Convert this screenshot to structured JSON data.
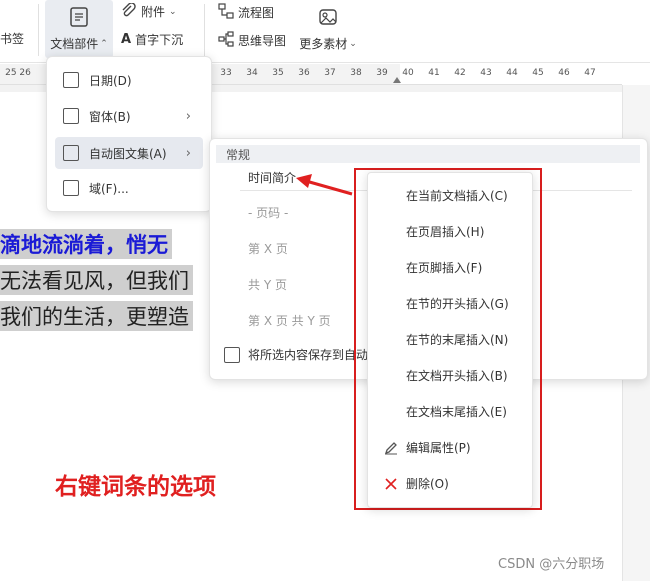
{
  "ribbon": {
    "bookmark_label": "书签",
    "doc_parts_label": "文档部件",
    "attachment_label": "附件",
    "drop_cap_label": "首字下沉",
    "flowchart_label": "流程图",
    "mindmap_label": "思维导图",
    "more_material_label": "更多素材"
  },
  "ruler": {
    "left_label": "25 26",
    "numbers": [
      "33",
      "34",
      "35",
      "36",
      "37",
      "38",
      "39",
      "40",
      "41",
      "42",
      "43",
      "44",
      "45",
      "46",
      "47"
    ]
  },
  "document": {
    "line1": "滴地流淌着，悄无",
    "line1_color": "#1a1ad6",
    "line2": "无法看见风，但我们",
    "line3": "我们的生活，更塑造"
  },
  "doc_parts_menu": {
    "items": [
      {
        "label": "日期(D)",
        "icon": "calendar-icon"
      },
      {
        "label": "窗体(B)",
        "icon": "form-icon"
      },
      {
        "label": "自动图文集(A)",
        "icon": "autotext-icon"
      },
      {
        "label": "域(F)...",
        "icon": "field-icon"
      }
    ]
  },
  "autotext_menu": {
    "header": "常规",
    "entries": [
      "时间简介",
      "- 页码 -",
      "第 X 页",
      "共 Y 页",
      "第 X 页 共 Y 页"
    ],
    "save_label": "将所选内容保存到自动"
  },
  "context_menu": {
    "items": [
      "在当前文档插入(C)",
      "在页眉插入(H)",
      "在页脚插入(F)",
      "在节的开头插入(G)",
      "在节的末尾插入(N)",
      "在文档开头插入(B)",
      "在文档末尾插入(E)",
      "编辑属性(P)",
      "删除(O)"
    ]
  },
  "annotation": {
    "caption": "右键词条的选项"
  },
  "watermark": "CSDN @六分职场",
  "colors": {
    "accent_red": "#e02020",
    "selection_gray": "#cfcfcf",
    "blue_text": "#1a1ad6"
  }
}
